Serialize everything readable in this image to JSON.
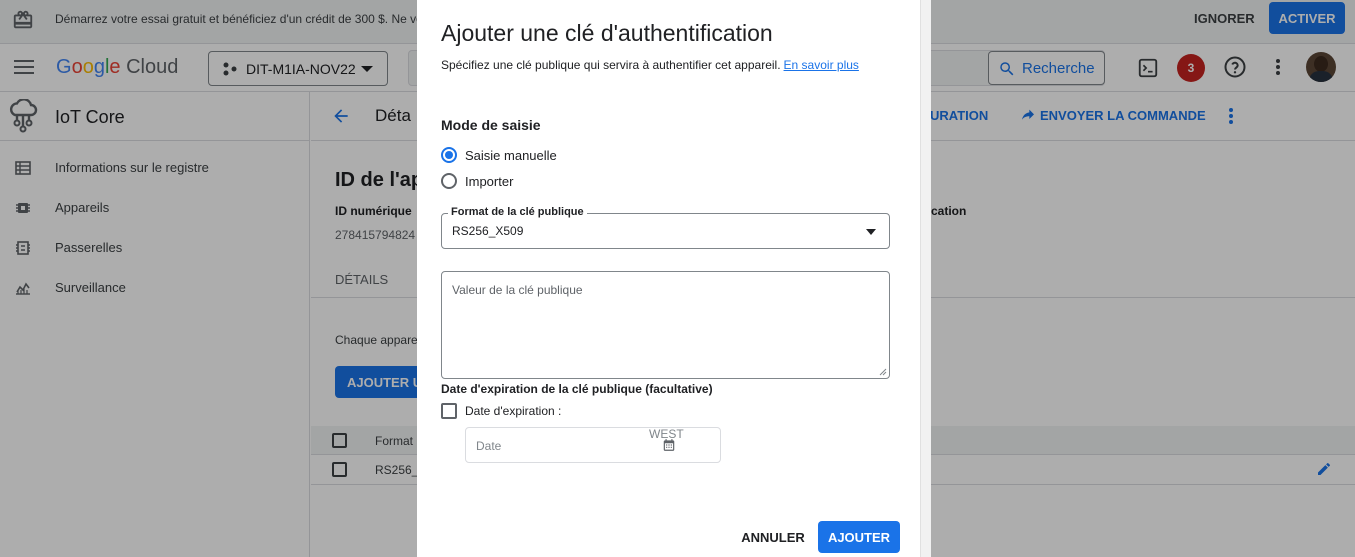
{
  "banner": {
    "message": "Démarrez votre essai gratuit et bénéficiez d'un crédit de 300 $. Ne vo",
    "ignore_label": "IGNORER",
    "activate_label": "ACTIVER"
  },
  "topbar": {
    "logo_parts": [
      "G",
      "o",
      "o",
      "g",
      "l",
      "e"
    ],
    "logo_suffix": "Cloud",
    "project_name": "DIT-M1IA-NOV22",
    "search_label": "Recherche",
    "notification_count": "3"
  },
  "sidebar": {
    "service_title": "IoT Core",
    "items": [
      {
        "label": "Informations sur le registre",
        "icon": "table-icon"
      },
      {
        "label": "Appareils",
        "icon": "chip-icon"
      },
      {
        "label": "Passerelles",
        "icon": "gateway-icon"
      },
      {
        "label": "Surveillance",
        "icon": "chart-icon"
      }
    ]
  },
  "main": {
    "page_title": "Déta",
    "action_config": "URATION",
    "action_send": "ENVOYER LA COMMANDE",
    "device_id_label": "ID de l'ap",
    "numeric_id_label": "ID numérique",
    "numeric_id_value": "278415794824",
    "communication_label": "cation",
    "tab_details": "DÉTAILS",
    "info_text": "Chaque appare",
    "add_button_label": "AJOUTER U",
    "table_header_format": "Format",
    "table_row_format": "RS256_"
  },
  "dialog": {
    "title": "Ajouter une clé d'authentification",
    "subtitle": "Spécifiez une clé publique qui servira à authentifier cet appareil.",
    "learn_more": "En savoir plus",
    "mode_title": "Mode de saisie",
    "radio_manual": "Saisie manuelle",
    "radio_import": "Importer",
    "format_legend": "Format de la clé publique",
    "format_value": "RS256_X509",
    "key_placeholder": "Valeur de la clé publique",
    "expiration_title": "Date d'expiration de la clé publique (facultative)",
    "expiration_checkbox": "Date d'expiration :",
    "date_placeholder": "Date",
    "timezone": "WEST",
    "cancel_label": "ANNULER",
    "add_label": "AJOUTER"
  },
  "colors": {
    "accent": "#1a73e8",
    "badge": "#c5221f",
    "overlay": "rgba(0,0,0,0.32)"
  }
}
